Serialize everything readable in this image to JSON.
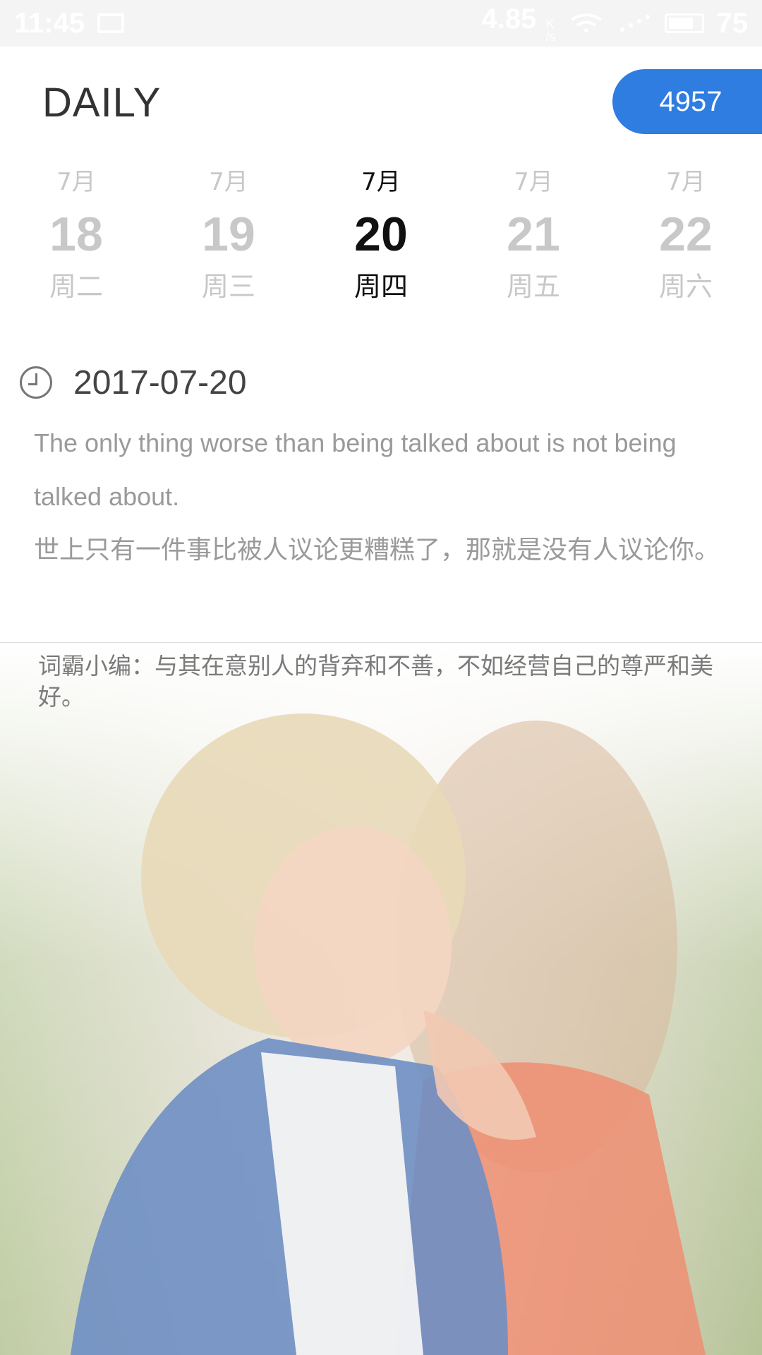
{
  "status_bar": {
    "time": "11:45",
    "speed": "4.85",
    "speed_unit_top": "K",
    "speed_unit_bottom": "/s",
    "battery": "75"
  },
  "header": {
    "title": "DAILY",
    "count": "4957"
  },
  "dates": [
    {
      "month": "7月",
      "day": "18",
      "weekday": "周二"
    },
    {
      "month": "7月",
      "day": "19",
      "weekday": "周三"
    },
    {
      "month": "7月",
      "day": "20",
      "weekday": "周四"
    },
    {
      "month": "7月",
      "day": "21",
      "weekday": "周五"
    },
    {
      "month": "7月",
      "day": "22",
      "weekday": "周六"
    }
  ],
  "entry": {
    "date": "2017-07-20",
    "quote_en": "The only thing worse than being talked about is not being talked about.",
    "quote_zh": "世上只有一件事比被人议论更糟糕了，那就是没有人议论你。",
    "editor_note": "词霸小编：与其在意别人的背弃和不善，不如经营自己的尊严和美好。"
  },
  "icons": {
    "mail": "mail-icon",
    "signal": "signal-icon",
    "battery": "battery-icon",
    "clock": "clock-icon"
  },
  "colors": {
    "accent": "#2f7de1",
    "inactive_date": "#c8c8c8",
    "active_date": "#111111",
    "quote_text": "#9a9a9a"
  }
}
